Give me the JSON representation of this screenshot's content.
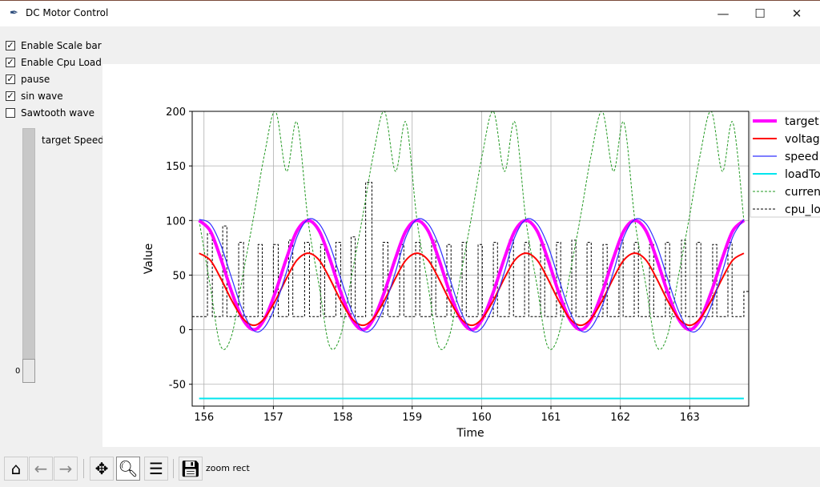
{
  "window": {
    "title": "DC Motor Control"
  },
  "controls": {
    "checkboxes": [
      {
        "label": "Enable Scale bar",
        "checked": true
      },
      {
        "label": "Enable Cpu Load",
        "checked": true
      },
      {
        "label": "pause",
        "checked": true
      },
      {
        "label": "sin wave",
        "checked": true
      },
      {
        "label": "Sawtooth wave",
        "checked": false
      }
    ],
    "slider": {
      "label": "target Speed",
      "value": "0"
    }
  },
  "toolbar": {
    "status": "zoom rect",
    "buttons": [
      "home",
      "back",
      "forward",
      "pan",
      "zoom",
      "configure-subplots",
      "save"
    ],
    "active": "zoom"
  },
  "chart_data": {
    "type": "line",
    "xlabel": "Time",
    "ylabel": "Value",
    "xlim": [
      155.83,
      163.85
    ],
    "ylim": [
      -70,
      200
    ],
    "xticks": [
      156,
      157,
      158,
      159,
      160,
      161,
      162,
      163
    ],
    "yticks": [
      -50,
      0,
      50,
      100,
      150,
      200
    ],
    "grid": true,
    "legend": "right (clipped)",
    "x": [
      155.93,
      156.09,
      156.24,
      156.4,
      156.56,
      156.72,
      156.87,
      157.03,
      157.19,
      157.34,
      157.5,
      157.66,
      157.81,
      157.97,
      158.13,
      158.29,
      158.44,
      158.6,
      158.76,
      158.91,
      159.07,
      159.23,
      159.38,
      159.54,
      159.7,
      159.86,
      160.01,
      160.17,
      160.33,
      160.48,
      160.64,
      160.8,
      160.95,
      161.11,
      161.27,
      161.43,
      161.58,
      161.74,
      161.9,
      162.05,
      162.21,
      162.37,
      162.52,
      162.68,
      162.84,
      163.0,
      163.15,
      163.31,
      163.47,
      163.62,
      163.78
    ],
    "series": [
      {
        "name": "target",
        "color": "#ff00ff",
        "width": 4,
        "dash": "",
        "values": [
          100,
          90.5,
          65.5,
          34.5,
          9.5,
          0,
          9.5,
          34.5,
          65.5,
          90.5,
          100,
          90.5,
          65.5,
          34.5,
          9.5,
          0,
          9.5,
          34.5,
          65.5,
          90.5,
          100,
          90.5,
          65.5,
          34.5,
          9.5,
          0,
          9.5,
          34.5,
          65.5,
          90.5,
          100,
          90.5,
          65.5,
          34.5,
          9.5,
          0,
          9.5,
          34.5,
          65.5,
          90.5,
          100,
          90.5,
          65.5,
          34.5,
          9.5,
          0,
          9.5,
          34.5,
          65.5,
          90.5,
          100
        ]
      },
      {
        "name": "voltag",
        "color": "#ff0000",
        "width": 2,
        "dash": "",
        "values": [
          70,
          63.7,
          47.2,
          26.8,
          10.3,
          4,
          10.3,
          26.8,
          47.2,
          63.7,
          70,
          63.7,
          47.2,
          26.8,
          10.3,
          4,
          10.3,
          26.8,
          47.2,
          63.7,
          70,
          63.7,
          47.2,
          26.8,
          10.3,
          4,
          10.3,
          26.8,
          47.2,
          63.7,
          70,
          63.7,
          47.2,
          26.8,
          10.3,
          4,
          10.3,
          26.8,
          47.2,
          63.7,
          70,
          63.7,
          47.2,
          26.8,
          10.3,
          4,
          10.3,
          26.8,
          47.2,
          63.7,
          70
        ]
      },
      {
        "name": "speed",
        "color": "#3030ff",
        "width": 1.2,
        "dash": "",
        "values": [
          101,
          97,
          78,
          47,
          17,
          -1,
          2,
          22,
          53,
          85,
          101,
          97,
          78,
          47,
          17,
          -1,
          2,
          22,
          53,
          85,
          101,
          97,
          78,
          47,
          17,
          -1,
          2,
          22,
          53,
          85,
          101,
          97,
          78,
          47,
          17,
          -1,
          2,
          22,
          53,
          85,
          101,
          97,
          78,
          47,
          17,
          -1,
          2,
          22,
          53,
          85,
          101
        ]
      },
      {
        "name": "loadTo",
        "color": "#00e5ee",
        "width": 2,
        "dash": "",
        "values": [
          -63,
          -63,
          -63,
          -63,
          -63,
          -63,
          -63,
          -63,
          -63,
          -63,
          -63,
          -63,
          -63,
          -63,
          -63,
          -63,
          -63,
          -63,
          -63,
          -63,
          -63,
          -63,
          -63,
          -63,
          -63,
          -63,
          -63,
          -63,
          -63,
          -63,
          -63,
          -63,
          -63,
          -63,
          -63,
          -63,
          -63,
          -63,
          -63,
          -63,
          -63,
          -63,
          -63,
          -63,
          -63,
          -63,
          -63,
          -63,
          -63,
          -63,
          -63
        ]
      },
      {
        "name": "curren",
        "color": "#229922",
        "width": 1,
        "dash": "3,2",
        "values": [
          100,
          40,
          -15,
          -5,
          50,
          105,
          160,
          200,
          145,
          190,
          100,
          40,
          -15,
          -5,
          50,
          105,
          160,
          200,
          145,
          190,
          100,
          40,
          -15,
          -5,
          50,
          105,
          160,
          200,
          145,
          190,
          100,
          40,
          -15,
          -5,
          50,
          105,
          160,
          200,
          145,
          190,
          100,
          40,
          -15,
          -5,
          50,
          105,
          160,
          200,
          145,
          190,
          100
        ]
      }
    ],
    "cpu_load": {
      "name": "cpu_lo",
      "color": "#000000",
      "baseline": 12,
      "pulses": [
        [
          156.05,
          156.12,
          88
        ],
        [
          156.27,
          156.33,
          95
        ],
        [
          156.5,
          156.57,
          80
        ],
        [
          156.78,
          156.84,
          78
        ],
        [
          157.0,
          157.07,
          78
        ],
        [
          157.22,
          157.28,
          82
        ],
        [
          157.45,
          157.52,
          80
        ],
        [
          157.68,
          157.74,
          78
        ],
        [
          157.9,
          157.97,
          80
        ],
        [
          158.12,
          158.18,
          85
        ],
        [
          158.33,
          158.42,
          135
        ],
        [
          158.58,
          158.65,
          80
        ],
        [
          158.82,
          158.88,
          78
        ],
        [
          159.05,
          159.11,
          80
        ],
        [
          159.28,
          159.34,
          82
        ],
        [
          159.5,
          159.56,
          78
        ],
        [
          159.72,
          159.78,
          80
        ],
        [
          159.95,
          160.01,
          78
        ],
        [
          160.17,
          160.23,
          80
        ],
        [
          160.4,
          160.46,
          82
        ],
        [
          160.62,
          160.68,
          80
        ],
        [
          160.85,
          160.91,
          78
        ],
        [
          161.08,
          161.14,
          80
        ],
        [
          161.3,
          161.36,
          82
        ],
        [
          161.52,
          161.58,
          80
        ],
        [
          161.75,
          161.81,
          78
        ],
        [
          161.98,
          162.04,
          82
        ],
        [
          162.2,
          162.26,
          80
        ],
        [
          162.42,
          162.48,
          78
        ],
        [
          162.65,
          162.71,
          80
        ],
        [
          162.88,
          162.94,
          82
        ],
        [
          163.1,
          163.16,
          80
        ],
        [
          163.33,
          163.39,
          78
        ],
        [
          163.55,
          163.61,
          80
        ],
        [
          163.78,
          163.85,
          35
        ]
      ]
    }
  }
}
